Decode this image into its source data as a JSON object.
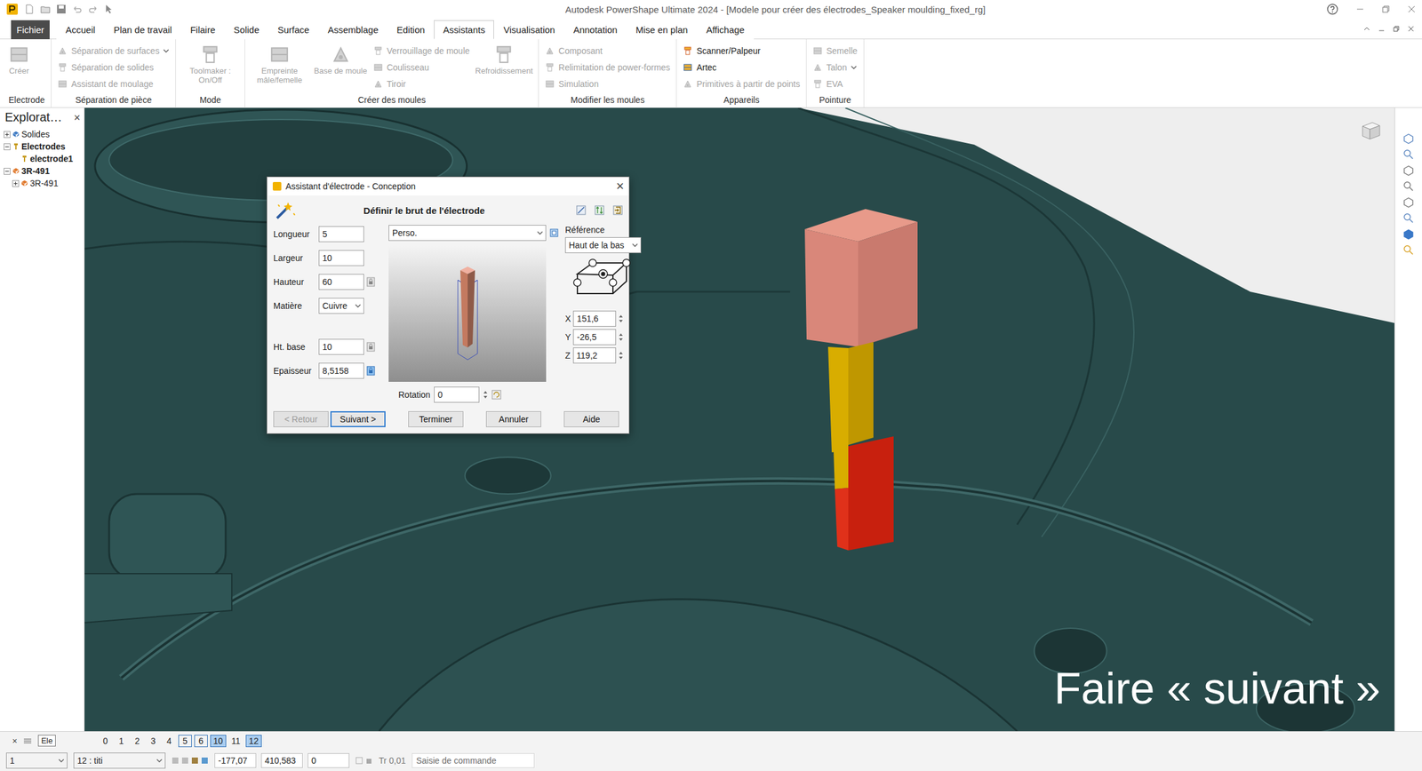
{
  "window": {
    "title": "Autodesk PowerShape Ultimate 2024 - [Modele pour créer des électrodes_Speaker moulding_fixed_rg]"
  },
  "tabs": [
    {
      "label": "Fichier",
      "selected": false,
      "kind": "file"
    },
    {
      "label": "Accueil",
      "selected": false,
      "kind": "tab"
    },
    {
      "label": "Plan de travail",
      "selected": false,
      "kind": "tab"
    },
    {
      "label": "Filaire",
      "selected": false,
      "kind": "tab"
    },
    {
      "label": "Solide",
      "selected": false,
      "kind": "tab"
    },
    {
      "label": "Surface",
      "selected": false,
      "kind": "tab"
    },
    {
      "label": "Assemblage",
      "selected": false,
      "kind": "tab"
    },
    {
      "label": "Edition",
      "selected": false,
      "kind": "tab"
    },
    {
      "label": "Assistants",
      "selected": true,
      "kind": "tab"
    },
    {
      "label": "Visualisation",
      "selected": false,
      "kind": "tab"
    },
    {
      "label": "Annotation",
      "selected": false,
      "kind": "tab"
    },
    {
      "label": "Mise en plan",
      "selected": false,
      "kind": "tab"
    },
    {
      "label": "Affichage",
      "selected": false,
      "kind": "tab"
    }
  ],
  "ribbon_groups": [
    {
      "label": "Electrode",
      "items": [
        {
          "label": "Créer",
          "kind": "large",
          "disabled": true,
          "has_menu": false
        }
      ]
    },
    {
      "label": "Séparation de pièce",
      "items": [
        {
          "label": "Séparation de surfaces",
          "kind": "small",
          "disabled": true,
          "has_menu": true
        },
        {
          "label": "Séparation de solides",
          "kind": "small",
          "disabled": true,
          "has_menu": false
        },
        {
          "label": "Assistant de moulage",
          "kind": "small",
          "disabled": true,
          "has_menu": false
        }
      ]
    },
    {
      "label": "Mode",
      "items": [
        {
          "label": "Toolmaker : On/Off",
          "kind": "large",
          "disabled": true,
          "has_menu": false
        }
      ]
    },
    {
      "label": "Créer des moules",
      "items": [
        {
          "label": "Empreinte mâle/femelle",
          "kind": "large",
          "disabled": true,
          "has_menu": false
        },
        {
          "label": "Base de moule",
          "kind": "large",
          "disabled": true,
          "has_menu": false
        },
        {
          "label": "Verrouillage de moule",
          "kind": "small",
          "disabled": true,
          "has_menu": false
        },
        {
          "label": "Coulisseau",
          "kind": "small",
          "disabled": true,
          "has_menu": false
        },
        {
          "label": "Tiroir",
          "kind": "small",
          "disabled": true,
          "has_menu": false
        },
        {
          "label": "Refroidissement",
          "kind": "large",
          "disabled": true,
          "has_menu": false
        }
      ]
    },
    {
      "label": "Modifier les moules",
      "items": [
        {
          "label": "Composant",
          "kind": "small",
          "disabled": true,
          "has_menu": false
        },
        {
          "label": "Relimitation de power-formes",
          "kind": "small",
          "disabled": true,
          "has_menu": false
        },
        {
          "label": "Simulation",
          "kind": "small",
          "disabled": true,
          "has_menu": false
        }
      ]
    },
    {
      "label": "Appareils",
      "items": [
        {
          "label": "Scanner/Palpeur",
          "kind": "small",
          "disabled": false,
          "has_menu": false
        },
        {
          "label": "Artec",
          "kind": "small",
          "disabled": false,
          "has_menu": false
        },
        {
          "label": "Primitives à partir de points",
          "kind": "small",
          "disabled": true,
          "has_menu": false
        }
      ]
    },
    {
      "label": "Pointure",
      "items": [
        {
          "label": "Semelle",
          "kind": "small",
          "disabled": true,
          "has_menu": false
        },
        {
          "label": "Talon",
          "kind": "small",
          "disabled": true,
          "has_menu": true
        },
        {
          "label": "EVA",
          "kind": "small",
          "disabled": true,
          "has_menu": false
        }
      ]
    }
  ],
  "explorer": {
    "title": "Explorat…",
    "close": "×",
    "items": [
      {
        "label": "Solides",
        "depth": 0,
        "bold": false,
        "expandable": true,
        "expanded": false,
        "kind": "solids"
      },
      {
        "label": "Electrodes",
        "depth": 0,
        "bold": true,
        "expandable": true,
        "expanded": true,
        "kind": "electrodes"
      },
      {
        "label": "electrode1",
        "depth": 1,
        "bold": true,
        "expandable": false,
        "expanded": false,
        "kind": "electrode"
      },
      {
        "label": "3R-491",
        "depth": 0,
        "bold": true,
        "expandable": true,
        "expanded": true,
        "kind": "assembly"
      },
      {
        "label": "3R-491",
        "depth": 1,
        "bold": false,
        "expandable": true,
        "expanded": false,
        "kind": "component"
      }
    ]
  },
  "dialog": {
    "title": "Assistant d'électrode - Conception",
    "close": "×",
    "heading": "Définir le brut de l'électrode",
    "fields": [
      {
        "label": "Longueur",
        "value": "5",
        "kind": "input"
      },
      {
        "label": "Largeur",
        "value": "10",
        "kind": "input"
      },
      {
        "label": "Hauteur",
        "value": "60",
        "kind": "input-lock",
        "locked": false
      },
      {
        "label": "Matière",
        "value": "Cuivre",
        "kind": "select"
      },
      {
        "label": "Ht. base",
        "value": "10",
        "kind": "input-lock",
        "locked": false
      },
      {
        "label": "Epaisseur",
        "value": "8,5158",
        "kind": "input-lock",
        "locked": true
      }
    ],
    "preset": "Perso.",
    "rotation_label": "Rotation",
    "rotation": "0",
    "reference_label": "Référence",
    "reference": "Haut de la bas",
    "coords": [
      {
        "axis": "X",
        "value": "151,6"
      },
      {
        "axis": "Y",
        "value": "-26,5"
      },
      {
        "axis": "Z",
        "value": "119,2"
      }
    ],
    "buttons": [
      {
        "label": "< Retour",
        "disabled": true,
        "default": false
      },
      {
        "label": "Suivant >",
        "disabled": false,
        "default": true
      },
      {
        "label": "Terminer",
        "disabled": false,
        "default": false
      },
      {
        "label": "Annuler",
        "disabled": false,
        "default": false
      },
      {
        "label": "Aide",
        "disabled": false,
        "default": false
      }
    ]
  },
  "caption": "Faire « suivant »",
  "level_bar": {
    "close": "×",
    "name_field": "Ele",
    "levels": [
      {
        "label": "0",
        "boxed": false,
        "selected": false
      },
      {
        "label": "1",
        "boxed": false,
        "selected": false
      },
      {
        "label": "2",
        "boxed": false,
        "selected": false
      },
      {
        "label": "3",
        "boxed": false,
        "selected": false
      },
      {
        "label": "4",
        "boxed": false,
        "selected": false
      },
      {
        "label": "5",
        "boxed": true,
        "selected": false
      },
      {
        "label": "6",
        "boxed": true,
        "selected": false
      },
      {
        "label": "10",
        "boxed": true,
        "selected": true
      },
      {
        "label": "11",
        "boxed": false,
        "selected": false
      },
      {
        "label": "12",
        "boxed": true,
        "selected": true
      }
    ]
  },
  "status_bar": {
    "level_select": "1",
    "layer_select": "12 : titi",
    "x": "-177,07",
    "y": "410,583",
    "z": "0",
    "tolerance_label": "Tr",
    "tolerance": "0,01",
    "command_placeholder": "Saisie de commande"
  }
}
